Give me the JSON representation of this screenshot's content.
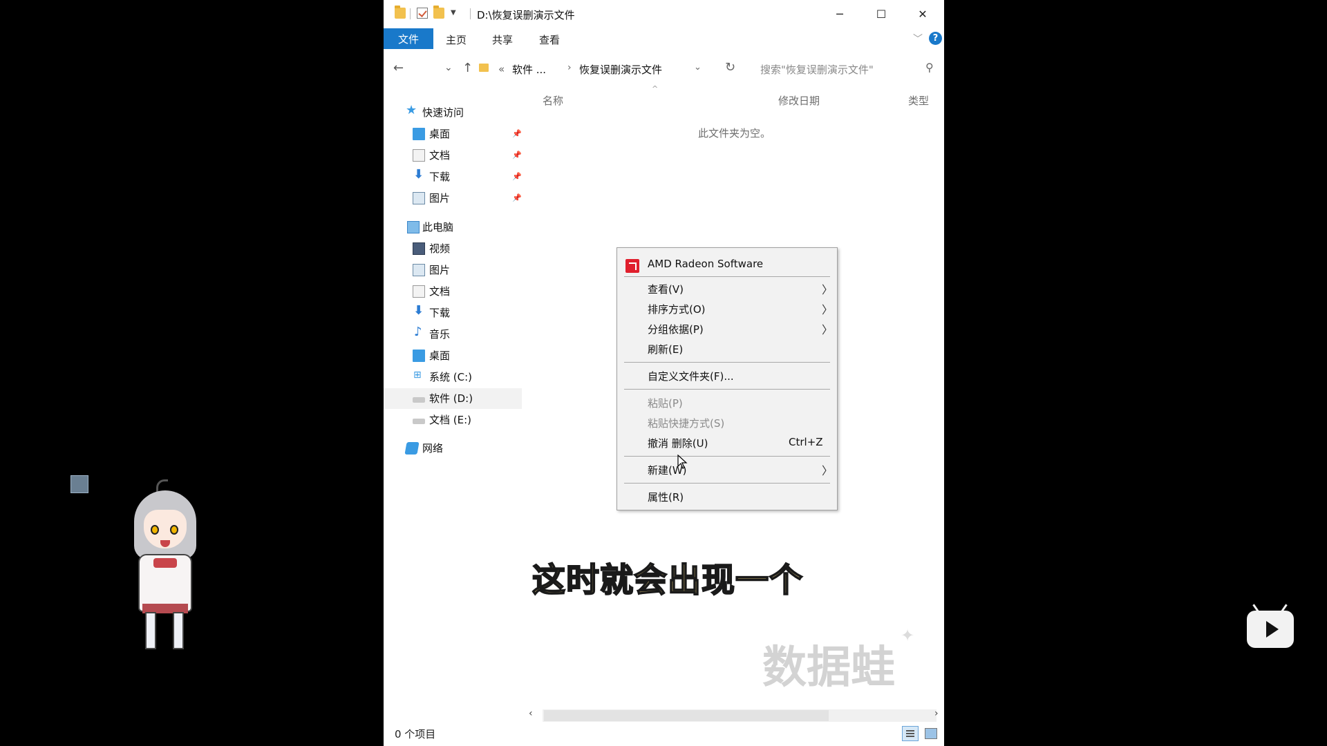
{
  "window": {
    "title": "D:\\恢复误删演示文件",
    "minimize": "─",
    "maximize": "☐",
    "close": "✕"
  },
  "ribbon": {
    "tabs": [
      "文件",
      "主页",
      "共享",
      "查看"
    ],
    "collapse": "﹀",
    "help": "?"
  },
  "address": {
    "back": "←",
    "recent": "⌄",
    "up": "↑",
    "prefix": "«",
    "crumb1": "软件 ...",
    "separator": "›",
    "crumb2": "恢复误删演示文件",
    "dropdown": "⌄",
    "refresh": "↻",
    "search_placeholder": "搜索\"恢复误删演示文件\"",
    "search_icon": "⚲"
  },
  "nav": {
    "quick_access": "快速访问",
    "quick_items": [
      "桌面",
      "文档",
      "下载",
      "图片"
    ],
    "pin": "📌",
    "this_pc": "此电脑",
    "pc_items": [
      "视频",
      "图片",
      "文档",
      "下载",
      "音乐",
      "桌面",
      "系统 (C:)",
      "软件 (D:)",
      "文档 (E:)"
    ],
    "network": "网络"
  },
  "columns": {
    "name": "名称",
    "date": "修改日期",
    "type": "类型",
    "sort_caret": "^"
  },
  "content": {
    "empty": "此文件夹为空。"
  },
  "context_menu": {
    "amd": "AMD Radeon Software",
    "view": "查看(V)",
    "sort": "排序方式(O)",
    "group": "分组依据(P)",
    "refresh": "刷新(E)",
    "customize": "自定义文件夹(F)...",
    "paste": "粘贴(P)",
    "paste_shortcut": "粘贴快捷方式(S)",
    "undo": "撤消 删除(U)",
    "undo_shortcut": "Ctrl+Z",
    "new": "新建(W)",
    "properties": "属性(R)",
    "submenu_arrow": "〉"
  },
  "scrollbar": {
    "left": "‹",
    "right": "›"
  },
  "status": {
    "count": "0 个项目"
  },
  "overlay": {
    "subtitle": "这时就会出现一个",
    "watermark": "数据蛙",
    "watermark_sparkle": "✦"
  },
  "colors": {
    "accent": "#1979ca",
    "subtitle": "#f4d884",
    "amd_red": "#e01f2d"
  }
}
